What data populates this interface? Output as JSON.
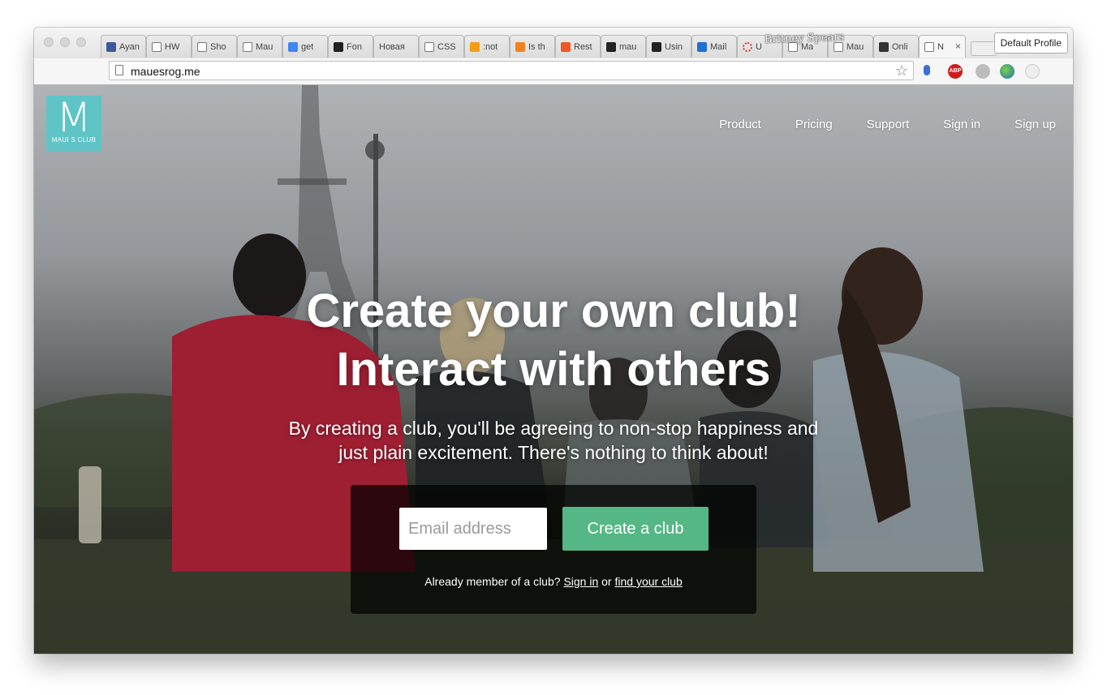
{
  "browser": {
    "tabs": [
      {
        "label": "Ayan",
        "icon": "facebook-icon",
        "color": "#3b5998"
      },
      {
        "label": "HW",
        "icon": "page-icon",
        "color": "#ffffff"
      },
      {
        "label": "Sho",
        "icon": "page-icon",
        "color": "#ffffff"
      },
      {
        "label": "Mau",
        "icon": "page-icon",
        "color": "#ffffff"
      },
      {
        "label": "get",
        "icon": "google-icon",
        "color": "#4285f4"
      },
      {
        "label": "Fon",
        "icon": "flag-icon",
        "color": "#222222"
      },
      {
        "label": "Новая",
        "icon": "none",
        "color": ""
      },
      {
        "label": "CSS",
        "icon": "page-icon",
        "color": "#ffffff"
      },
      {
        "label": ":not",
        "icon": "asterisk-icon",
        "color": "#f39c12"
      },
      {
        "label": "Is th",
        "icon": "stack-icon",
        "color": "#f48024"
      },
      {
        "label": "Rest",
        "icon": "wave-icon",
        "color": "#ef5a24"
      },
      {
        "label": "mau",
        "icon": "github-icon",
        "color": "#222222"
      },
      {
        "label": "Usin",
        "icon": "github-icon",
        "color": "#222222"
      },
      {
        "label": "Mail",
        "icon": "mail-icon",
        "color": "#1f6fd4"
      },
      {
        "label": "U",
        "icon": "ring-icon",
        "color": "#d63b2b"
      },
      {
        "label": "Ma",
        "icon": "page-icon",
        "color": "#ffffff"
      },
      {
        "label": "Mau",
        "icon": "page-icon",
        "color": "#ffffff"
      },
      {
        "label": "Onli",
        "icon": "d-icon",
        "color": "#333333"
      },
      {
        "label": "N",
        "icon": "page-icon",
        "color": "#ffffff"
      }
    ],
    "watermark": "Britney Spears",
    "profile_button": "Default Profile",
    "url": "mauesrog.me"
  },
  "site": {
    "logo_letter": "M",
    "logo_text": "MAUI S CLUB",
    "logo_color": "#5ec4c6",
    "nav": [
      "Product",
      "Pricing",
      "Support",
      "Sign in",
      "Sign up"
    ],
    "hero_title_line1": "Create your own club!",
    "hero_title_line2": "Interact with others",
    "hero_subtitle": "By creating a club, you'll be agreeing to non-stop happiness and just plain excitement. There's nothing to think about!",
    "email_placeholder": "Email address",
    "create_button": "Create a club",
    "create_button_color": "#55b785",
    "member_prefix": "Already member of a club?",
    "member_signin": "Sign in",
    "member_or": "or",
    "member_find": "find your club"
  }
}
